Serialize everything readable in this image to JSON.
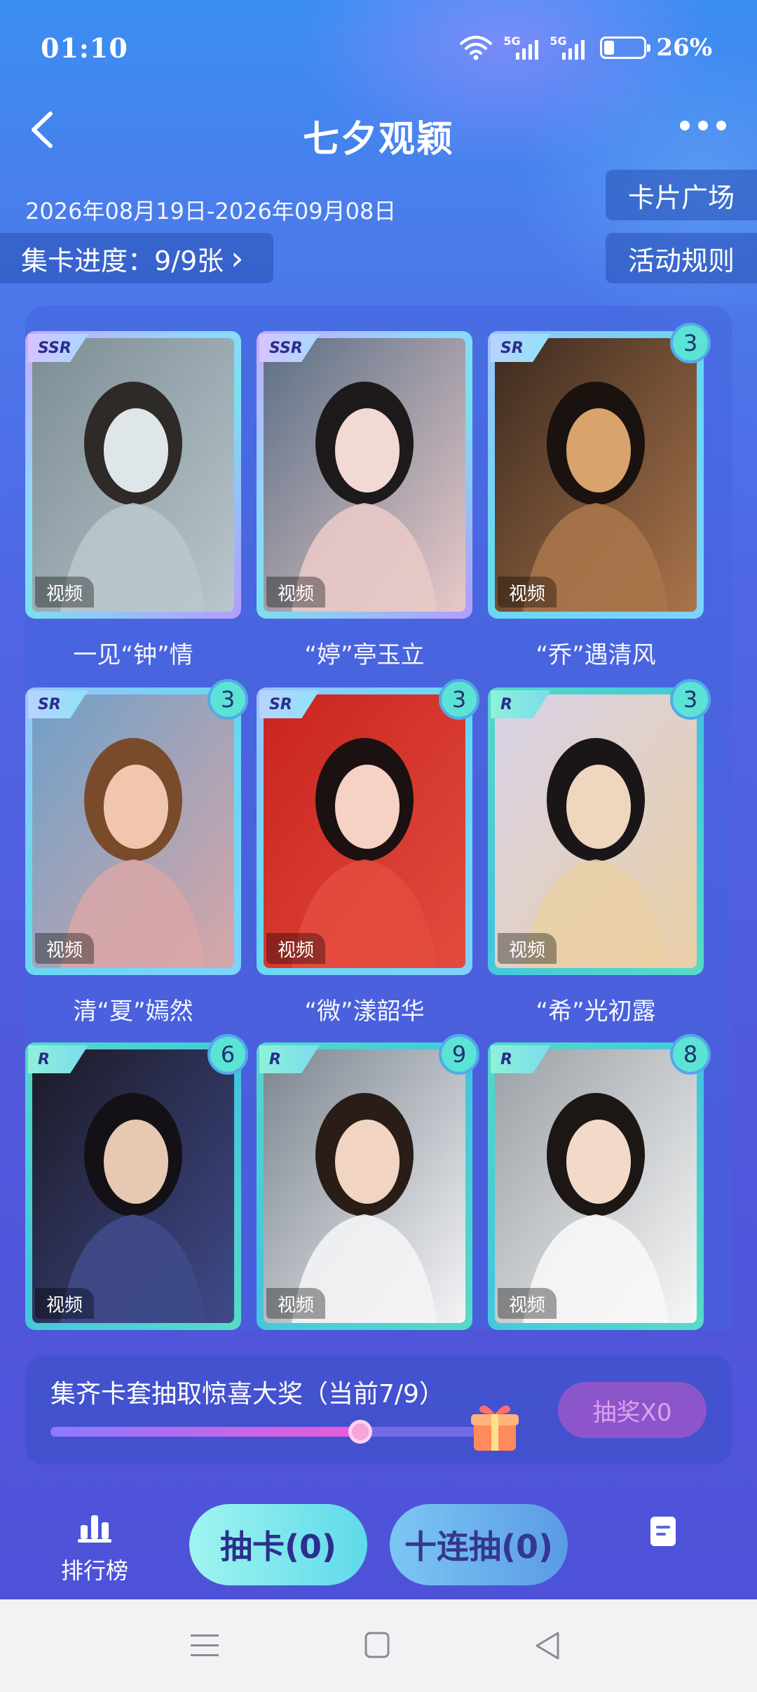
{
  "status_bar": {
    "time": "01:10",
    "signal_labels": [
      "5G",
      "5G"
    ],
    "battery_percent": "26%",
    "battery_level": 0.26
  },
  "header": {
    "title": "七夕观颖",
    "back_icon": "chevron-left-icon",
    "more_icon": "more-dots-icon"
  },
  "activity": {
    "date_range": "2026年08月19日-2026年09月08日",
    "card_plaza_label": "卡片广场",
    "rules_label": "活动规则",
    "progress_label": "集卡进度：9/9张",
    "progress_chevron": "›"
  },
  "cards": [
    {
      "rarity": "SSR",
      "name": "一见“钟”情",
      "tag": "视频",
      "count": ""
    },
    {
      "rarity": "SSR",
      "name": "“婷”亭玉立",
      "tag": "视频",
      "count": ""
    },
    {
      "rarity": "SR",
      "name": "“乔”遇清风",
      "tag": "视频",
      "count": "3"
    },
    {
      "rarity": "SR",
      "name": "清“夏”嫣然",
      "tag": "视频",
      "count": "3"
    },
    {
      "rarity": "SR",
      "name": "“微”漾韶华",
      "tag": "视频",
      "count": "3"
    },
    {
      "rarity": "R",
      "name": "“希”光初露",
      "tag": "视频",
      "count": "3"
    },
    {
      "rarity": "R",
      "name": "",
      "tag": "视频",
      "count": "6"
    },
    {
      "rarity": "R",
      "name": "",
      "tag": "视频",
      "count": "9"
    },
    {
      "rarity": "R",
      "name": "",
      "tag": "视频",
      "count": "8"
    }
  ],
  "prize": {
    "text": "集齐卡套抽取惊喜大奖（当前7/9）",
    "progress": 0.778,
    "gift_icon": "gift-icon",
    "button_label": "抽奖X0"
  },
  "bottom": {
    "ranking_label": "排行榜",
    "ranking_icon": "bar-chart-icon",
    "draw_label": "抽卡(0)",
    "ten_draw_label": "十连抽(0)",
    "doc_icon": "document-icon"
  },
  "nav": {
    "icons": [
      "menu-icon",
      "home-square-icon",
      "back-triangle-icon"
    ]
  },
  "colors": {
    "background_top": "#3b8ef2",
    "background_bottom": "#4e52d8",
    "accent_cyan": "#5fd9ea",
    "prize_pink": "#e95ad8"
  }
}
